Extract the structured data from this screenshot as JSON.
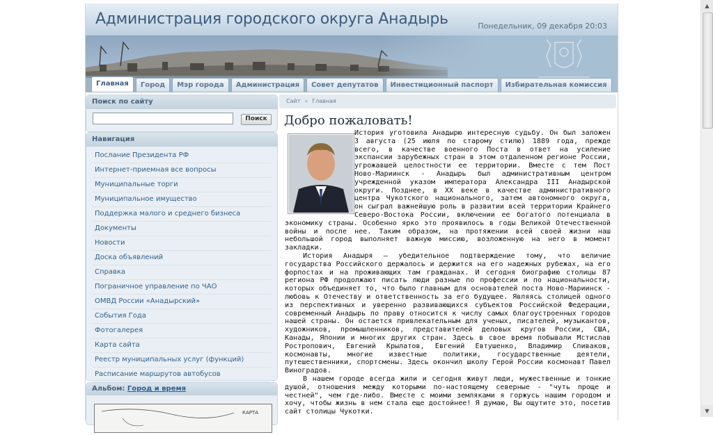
{
  "header": {
    "title": "Администрация городского округа Анадырь",
    "date": "Понедельник, 09 декабря 20:03"
  },
  "tabs": [
    {
      "label": "Главная",
      "active": true
    },
    {
      "label": "Город"
    },
    {
      "label": "Мэр города"
    },
    {
      "label": "Администрация"
    },
    {
      "label": "Совет депутатов"
    },
    {
      "label": "Инвестиционный паспорт"
    },
    {
      "label": "Избирательная комиссия"
    }
  ],
  "search": {
    "title": "Поиск по сайту",
    "placeholder": "",
    "button": "Поиск"
  },
  "navigation": {
    "title": "Навигация",
    "items": [
      "Послание Президента РФ",
      "Интернет-приемная все вопросы",
      "Муниципальные торги",
      "Муниципальное имущество",
      "Поддержка малого и среднего бизнеса",
      "Документы",
      "Новости",
      "Доска объявлений",
      "Справка",
      "Пограничное управление по ЧАО",
      "ОМВД России «Анадырский»",
      "События Года",
      "Фотогалерея",
      "Карта сайта",
      "Реестр муниципальных услуг (функций)",
      "Расписание маршрутов автобусов"
    ]
  },
  "album": {
    "label": "Альбом:",
    "link": "Город и время",
    "thumb_text": "КАРТА"
  },
  "breadcrumb": {
    "root": "Сайт",
    "sep": "»",
    "current": "Главная"
  },
  "content": {
    "title": "Добро пожаловать!",
    "paragraphs": [
      "История уготовила Анадырю интересную судьбу. Он был заложен 3 августа (25 июля по старому стилю) 1889 года, прежде всего, в качестве военного Поста в ответ на усиление экспансии зарубежных стран в этом отдаленном регионе России, угрожавшей целостности ее территории. Вместе с тем Пост Ново-Мариинск - Анадырь был административным центром учрежденной указом императора Александра III Анадырской округи. Позднее, в XX веке в качестве административного центра Чукотского национального, затем автономного округа, он сыграл важнейшую роль в развитии всей территории Крайнего Северо-Востока России, включении ее богатого потенциала в экономику страны. Особенно ярко это проявилось в годы Великой Отечественной войны и после нее. Таким образом, на протяжении всей своей жизни наш небольшой город выполняет важную миссию, возложенную на него в момент закладки.",
      "История Анадыря – убедительное подтверждение тому, что величие государства Российского держалось и держится на его надежных рубежах, на его форпостах и на проживающих там гражданах. И сегодня биографию столицы 87 региона РФ продолжают писать люди разные по профессии и по национальности, которых объединяет то, что было главным для основателей поста Ново-Мариинск - любовь к Отечеству и ответственность за его будущее. Являясь столицей одного из перспективных и уверенно развивающихся субъектов Российской Федерации, современный Анадырь по праву относится к числу самых благоустроенных городов нашей страны. Он остается привлекательным для ученых, писателей, музыкантов, художников, промышленников, представителей деловых кругов России, США, Канады, Японии и многих других стран. Здесь в свое время побывали Мстислав Ростропович, Евгений Крылатов, Евгений Евтушенко, Владимир Спиваков, космонавты, многие известные политики, государственные деятели, путешественники, спортсмены. Здесь окончил школу Герой России космонавт Павел Виноградов.",
      "В нашем городе всегда жили и сегодня живут люди, мужественные и тонкие душой, отношения между которыми по-настоящему северные - \"чуть проще и честней\", чем где-либо. Вместе с моими земляками я горжусь нашим городом и хочу, чтобы жизнь в нем стала еще достойнее! Я думаю, Вы ощутите это, посетив сайт столицы Чукотки."
    ]
  },
  "colors": {
    "title": "#3b5c7e",
    "link": "#305f8c",
    "header_bg": "#b3c8db"
  }
}
